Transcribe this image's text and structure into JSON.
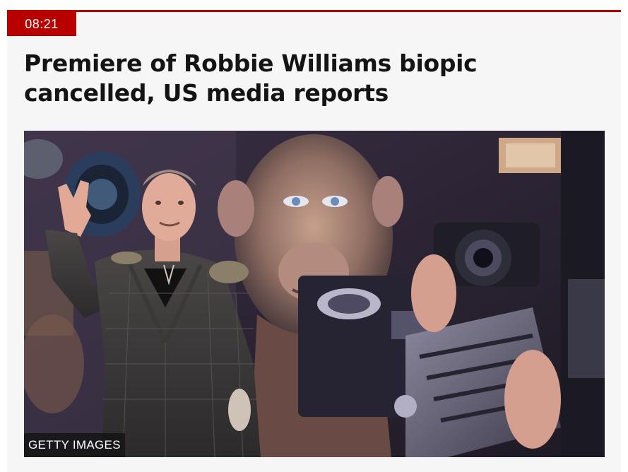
{
  "article": {
    "timestamp": "08:21",
    "headline": "Premiere of Robbie Williams biopic cancelled, US media reports",
    "image": {
      "alt": "Robbie Williams waving in front of a backdrop showing a chimpanzee holding an old camera",
      "credit": "GETTY IMAGES"
    }
  },
  "colors": {
    "accent": "#b80000",
    "card_background": "#f6f6f6",
    "headline_text": "#141414"
  }
}
